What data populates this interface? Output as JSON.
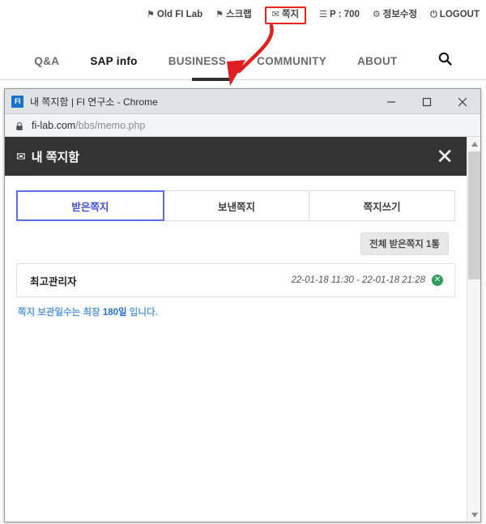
{
  "site": {
    "utilbar": [
      {
        "icon": "flag-icon",
        "glyph": "⚑",
        "label": "Old FI Lab",
        "highlighted": false
      },
      {
        "icon": "pin-icon",
        "glyph": "⚑",
        "label": "스크랩",
        "highlighted": false
      },
      {
        "icon": "envelope-icon",
        "glyph": "✉",
        "label": "쪽지",
        "highlighted": true
      },
      {
        "icon": "list-icon",
        "glyph": "☰",
        "label": "P : 700",
        "highlighted": false
      },
      {
        "icon": "gear-icon",
        "glyph": "⚙",
        "label": "정보수정",
        "highlighted": false
      },
      {
        "icon": "power-icon",
        "glyph": "⏻",
        "label": "LOGOUT",
        "highlighted": false
      }
    ],
    "nav": [
      {
        "label": "Q&A",
        "active": false
      },
      {
        "label": "SAP info",
        "active": true
      },
      {
        "label": "BUSINESS",
        "active": false
      },
      {
        "label": "COMMUNITY",
        "active": false
      },
      {
        "label": "ABOUT",
        "active": false
      }
    ],
    "search_icon": "search-icon",
    "highlight_color": "#e8251f",
    "arrow_color": "#e02020"
  },
  "window": {
    "favicon_text": "FI",
    "title": "내 쪽지함 | FI 연구소 - Chrome",
    "controls": {
      "minimize": "minimize-icon",
      "maximize": "maximize-icon",
      "close": "close-icon"
    },
    "url_domain": "fi-lab.com",
    "url_path": "/bbs/memo.php",
    "lock_icon": "lock-icon"
  },
  "memo": {
    "header_title": "내 쪽지함",
    "header_icon": "envelope-icon",
    "close_label": "✕",
    "tabs": [
      {
        "label": "받은쪽지",
        "active": true
      },
      {
        "label": "보낸쪽지",
        "active": false
      },
      {
        "label": "쪽지쓰기",
        "active": false
      }
    ],
    "count_button": "전체 받은쪽지 1통",
    "messages": [
      {
        "sender": "최고관리자",
        "date": "22-01-18 11:30 - 22-01-18 21:28",
        "delete_label": "✕"
      }
    ],
    "notice_prefix": "쪽지 보관일수는 최장 ",
    "notice_value": "180일",
    "notice_suffix": " 입니다.",
    "accent_color": "#5c6fe8",
    "header_bg": "#333333",
    "delete_color": "#2e9e5b"
  }
}
